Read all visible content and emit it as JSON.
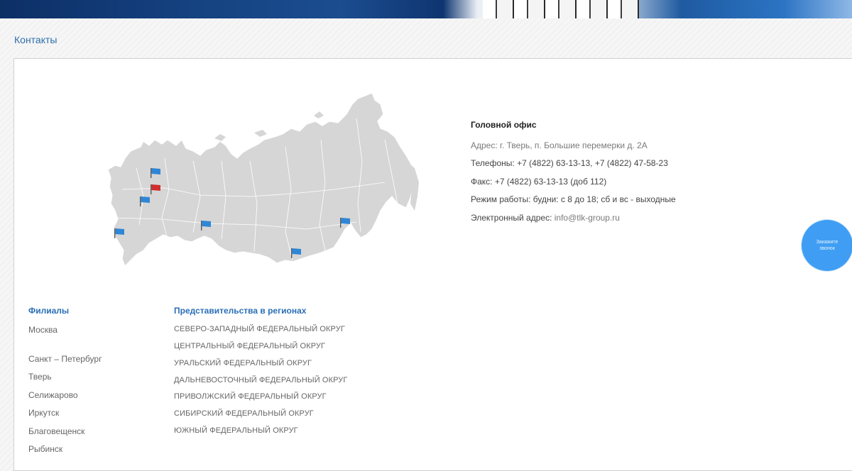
{
  "page": {
    "title": "Контакты"
  },
  "head_office": {
    "heading": "Головной офис",
    "address_label": "Адрес:",
    "address_value": "г. Тверь, п. Большие перемерки д. 2А",
    "phones_label": "Телефоны:",
    "phones_value": "+7 (4822) 63-13-13, +7 (4822) 47-58-23",
    "fax_label": "Факс:",
    "fax_value": "+7 (4822) 63-13-13 (доб 112)",
    "hours_label": "Режим работы:",
    "hours_value": "будни: с 8 до 18; сб и вс - выходные",
    "email_label": "Электронный адрес:",
    "email_value": "info@tlk-group.ru"
  },
  "branches": {
    "heading": "Филиалы",
    "items": [
      "Москва",
      "Санкт – Петербург",
      "Тверь",
      "Селижарово",
      "Иркутск",
      "Благовещенск",
      "Рыбинск"
    ]
  },
  "regions": {
    "heading": "Представительства в регионах",
    "items": [
      "СЕВЕРО-ЗАПАДНЫЙ ФЕДЕРАЛЬНЫЙ ОКРУГ",
      "ЦЕНТРАЛЬНЫЙ ФЕДЕРАЛЬНЫЙ ОКРУГ",
      "УРАЛЬСКИЙ ФЕДЕРАЛЬНЫЙ ОКРУГ",
      "ДАЛЬНЕВОСТОЧНЫЙ ФЕДЕРАЛЬНЫЙ ОКРУГ",
      "ПРИВОЛЖСКИЙ ФЕДЕРАЛЬНЫЙ ОКРУГ",
      "СИБИРСКИЙ ФЕДЕРАЛЬНЫЙ ОКРУГ",
      "ЮЖНЫЙ ФЕДЕРАЛЬНЫЙ ОКРУГ"
    ]
  },
  "callback_button": {
    "label": "Закажите звонок"
  },
  "colors": {
    "accent": "#2a6fb5",
    "title": "#2e6fae",
    "map_fill": "#d6d6d6",
    "flag_blue": "#2f86d6",
    "flag_red": "#d02f2f",
    "callback": "#3f9ef3"
  },
  "map": {
    "flags": [
      {
        "color": "blue",
        "name": "flag-st-petersburg-icon"
      },
      {
        "color": "red",
        "name": "flag-tver-icon"
      },
      {
        "color": "blue",
        "name": "flag-moscow-icon"
      },
      {
        "color": "blue",
        "name": "flag-south-icon"
      },
      {
        "color": "blue",
        "name": "flag-ural-icon"
      },
      {
        "color": "blue",
        "name": "flag-irkutsk-icon"
      },
      {
        "color": "blue",
        "name": "flag-blagoveshchensk-icon"
      }
    ]
  }
}
